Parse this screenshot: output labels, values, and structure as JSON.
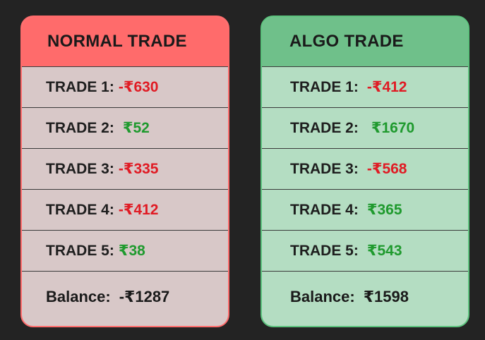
{
  "normal": {
    "title": "NORMAL TRADE",
    "header_color": "#ff6b6b",
    "trades": [
      {
        "label": "TRADE 1:",
        "value": "-₹630",
        "status": "negative"
      },
      {
        "label": "TRADE 2:",
        "value": "₹52",
        "status": "positive"
      },
      {
        "label": "TRADE 3:",
        "value": "-₹335",
        "status": "negative"
      },
      {
        "label": "TRADE 4:",
        "value": "-₹412",
        "status": "negative"
      },
      {
        "label": "TRADE 5:",
        "value": "₹38",
        "status": "positive"
      }
    ],
    "balance_label": "Balance:",
    "balance_value": "-₹1287"
  },
  "algo": {
    "title": "ALGO TRADE",
    "header_color": "#6fc08a",
    "trades": [
      {
        "label": "TRADE 1:",
        "value": "-₹412",
        "status": "negative"
      },
      {
        "label": "TRADE 2:",
        "value": "₹1670",
        "status": "positive"
      },
      {
        "label": "TRADE 3:",
        "value": "-₹568",
        "status": "negative"
      },
      {
        "label": "TRADE 4:",
        "value": "₹365",
        "status": "positive"
      },
      {
        "label": "TRADE 5:",
        "value": "₹543",
        "status": "positive"
      }
    ],
    "balance_label": "Balance:",
    "balance_value": "₹1598"
  }
}
